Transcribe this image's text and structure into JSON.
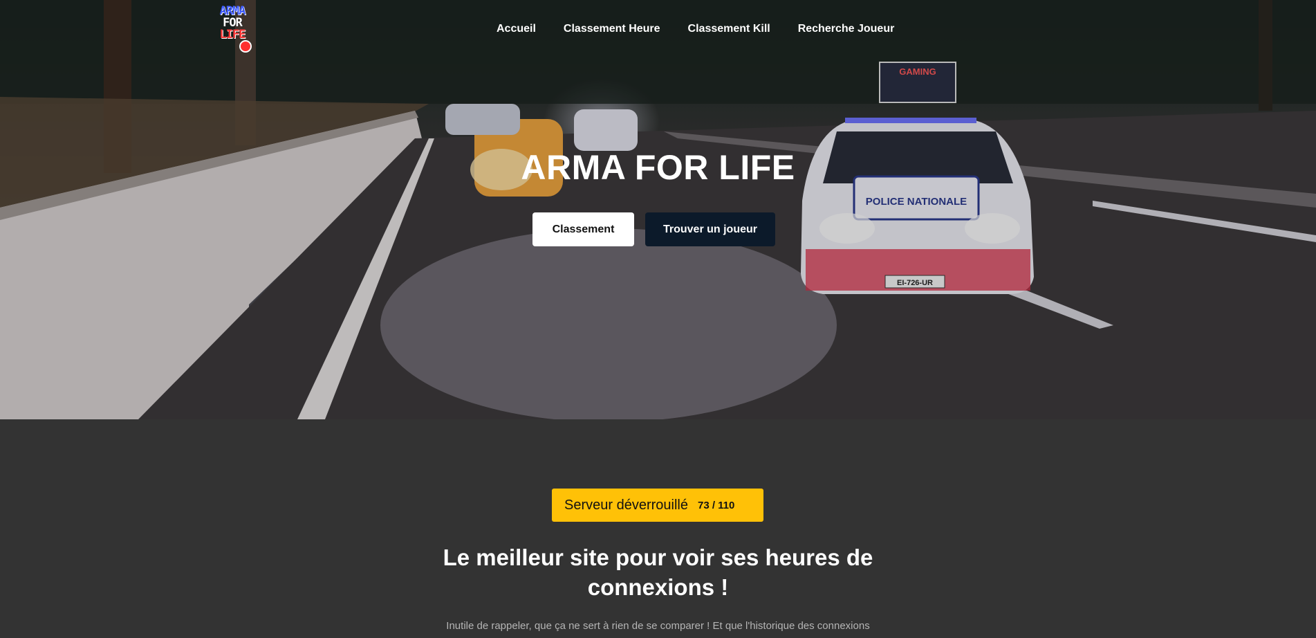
{
  "logo": {
    "line1": "ARMA",
    "line2": "FOR",
    "line3": "LIFE"
  },
  "nav": {
    "items": [
      {
        "label": "Accueil"
      },
      {
        "label": "Classement Heure"
      },
      {
        "label": "Classement Kill"
      },
      {
        "label": "Recherche Joueur"
      }
    ]
  },
  "hero": {
    "title": "ARMA FOR LIFE",
    "primary_button": "Classement",
    "secondary_button": "Trouver un joueur",
    "scene_texts": {
      "billboard": "GAMING",
      "car_door": "POLICE NATIONALE",
      "plate": "EI-726-UR"
    }
  },
  "status": {
    "label": "Serveur déverrouillé",
    "count": "73 / 110"
  },
  "section": {
    "title_line1": "Le meilleur site pour voir ses heures de",
    "title_line2": "connexions !",
    "text": "Inutile de rappeler, que ça ne sert à rien de se comparer ! Et que l'historique des connexions"
  },
  "colors": {
    "accent_yellow": "#ffc107",
    "dark_button": "#0c1a2a",
    "background": "#333333"
  }
}
